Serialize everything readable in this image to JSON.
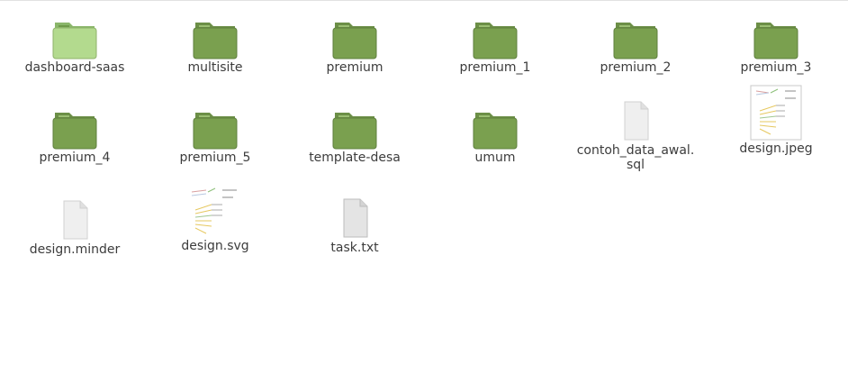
{
  "items": [
    {
      "name": "dashboard-saas",
      "type": "folder",
      "selected": true
    },
    {
      "name": "multisite",
      "type": "folder"
    },
    {
      "name": "premium",
      "type": "folder"
    },
    {
      "name": "premium_1",
      "type": "folder"
    },
    {
      "name": "premium_2",
      "type": "folder"
    },
    {
      "name": "premium_3",
      "type": "folder"
    },
    {
      "name": "premium_4",
      "type": "folder"
    },
    {
      "name": "premium_5",
      "type": "folder"
    },
    {
      "name": "template-desa",
      "type": "folder"
    },
    {
      "name": "umum",
      "type": "folder"
    },
    {
      "name": "contoh_data_awal.\nsql",
      "type": "document"
    },
    {
      "name": "design.jpeg",
      "type": "image-thumb"
    },
    {
      "name": "design.minder",
      "type": "document"
    },
    {
      "name": "design.svg",
      "type": "image-thumb"
    },
    {
      "name": "task.txt",
      "type": "text-document"
    }
  ],
  "colors": {
    "folder_top": "#7fa25a",
    "folder_body": "#7aa04f",
    "folder_selected": "#b2d88a",
    "document": "#ececec"
  }
}
